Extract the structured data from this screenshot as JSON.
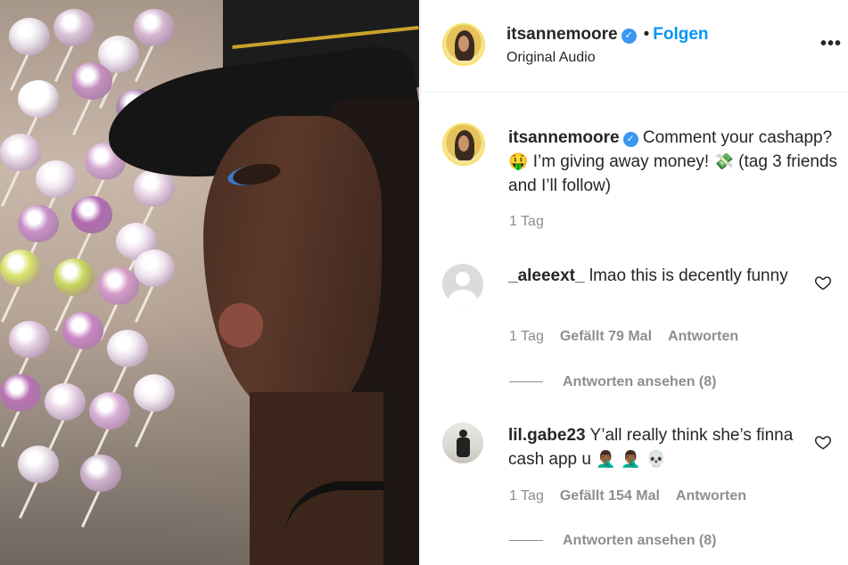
{
  "post": {
    "username": "itsannemoore",
    "follow_label": "Folgen",
    "separator": "•",
    "audio": "Original Audio",
    "more_label": "•••"
  },
  "caption": {
    "username": "itsannemoore",
    "text_1": "Comment your cashapp?",
    "emoji_1": "🤑",
    "text_2": "I’m giving away money!",
    "emoji_2": "💸",
    "text_3": "(tag 3 friends and I’ll follow)",
    "time": "1 Tag"
  },
  "comments": [
    {
      "username": "_aleeext_",
      "text": "lmao this is decently funny",
      "time": "1 Tag",
      "likes": "Gefällt 79 Mal",
      "reply_label": "Antworten",
      "view_replies": "Antworten ansehen (8)"
    },
    {
      "username": "lil.gabe23",
      "text": "Y’all really think she’s finna cash app u",
      "emojis": "🤦🏾‍♂️ 🤦🏾‍♂️ 💀",
      "time": "1 Tag",
      "likes": "Gefällt 154 Mal",
      "reply_label": "Antworten",
      "view_replies": "Antworten ansehen (8)"
    }
  ],
  "icons": {
    "verified": "verified-badge-icon",
    "heart": "heart-outline-icon",
    "more": "more-options-icon"
  },
  "colors": {
    "link_blue": "#0095f6",
    "verified_blue": "#3897f0",
    "secondary_text": "#8e8e8e"
  }
}
